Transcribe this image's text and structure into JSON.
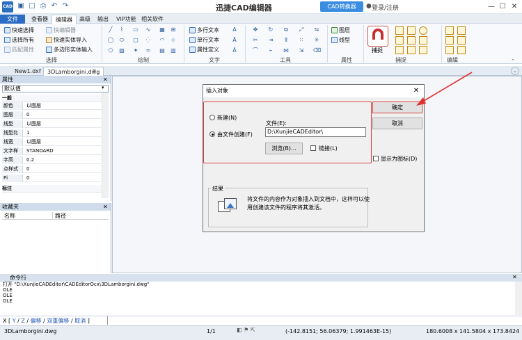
{
  "app": {
    "logo_text": "CAD",
    "title": "迅捷CAD编辑器",
    "convert_label": "CAD转换器",
    "login_label": "登录/注册"
  },
  "menu_tabs": [
    "文件",
    "查看器",
    "编辑器",
    "高级",
    "输出",
    "VIP功能",
    "相关软件"
  ],
  "ribbon": {
    "select_items": [
      "快速选择",
      "选择所有",
      "匹配属性"
    ],
    "block_items": [
      "快编辑器",
      "快速实体导入",
      "多边形实体输入"
    ],
    "text_items": [
      "多行文本",
      "单行文本",
      "属性定义"
    ],
    "prop_items": [
      "图层",
      "线型"
    ],
    "snap_label": "捕捉",
    "groups": [
      "选择",
      "绘制",
      "文字",
      "工具",
      "属性",
      "捕捉",
      "编辑"
    ]
  },
  "doc_tabs": [
    "New1.dxf",
    "3DLamborgini.dwg"
  ],
  "properties": {
    "title": "属性",
    "dropdown_value": "默认值",
    "section_general": "一般",
    "rows": [
      {
        "key": "颜色",
        "value": "以图层"
      },
      {
        "key": "图层",
        "value": "0"
      },
      {
        "key": "线型",
        "value": "以图层"
      },
      {
        "key": "线型比例",
        "value": "1"
      },
      {
        "key": "线宽",
        "value": "以图层"
      },
      {
        "key": "文字样式",
        "value": "STANDARD"
      },
      {
        "key": "字高",
        "value": "0.2"
      },
      {
        "key": "点样式",
        "value": "0"
      },
      {
        "key": "Pi",
        "value": "0"
      }
    ],
    "section_annotation": "标注"
  },
  "favorites": {
    "title": "收藏夹",
    "col_name": "名称",
    "col_path": "路径"
  },
  "dialog": {
    "title": "插入对象",
    "radio_new": "新建(N)",
    "radio_from_file": "由文件创建(F)",
    "file_label": "文件(E):",
    "file_value": "D:\\XunjieCADEditor\\",
    "browse_label": "浏览(B)...",
    "link_label": "链接(L)",
    "ok_label": "确定",
    "cancel_label": "取消",
    "display_icon_label": "显示为图标(D)",
    "result_title": "结果",
    "result_text_1": "将文件的内容作为对象插入到文档中，这样可以使",
    "result_text_2": "用创建该文件的程序将其激活。"
  },
  "command": {
    "title": "命令行",
    "log": [
      "打开 \"D:\\XunjieCADEditor\\CADEditorOcx\\3DLamborgini.dwg\"",
      "OLE",
      "OLE",
      "OLE"
    ],
    "prompt_prefix": "X [",
    "prompt_y": "Y",
    "prompt_z": "Z",
    "prompt_offset": "偏移",
    "prompt_double_offset": "双重偏移",
    "prompt_cancel": "取消",
    "prompt_suffix": "]"
  },
  "status": {
    "filename": "3DLamborgini.dwg",
    "page": "1/1",
    "coords": "(-142.8151; 56.06379; 1.991463E-15)",
    "dims": "180.6008 x 141.5804 x 173.8424"
  },
  "colors": {
    "accent": "#2b6cc4",
    "highlight_red": "#d64040"
  }
}
